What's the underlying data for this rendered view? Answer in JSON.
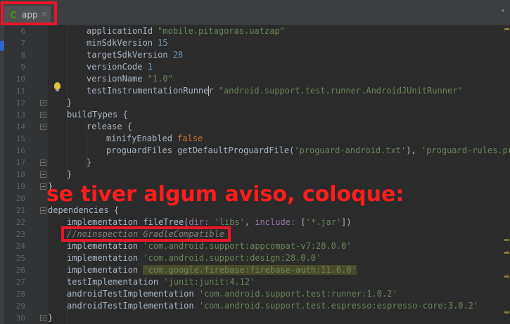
{
  "tab": {
    "label": "app",
    "close": "×"
  },
  "annotation": {
    "text": "se tiver algum aviso, coloque:"
  },
  "editor": {
    "line_numbers": [
      "6",
      "7",
      "8",
      "9",
      "10",
      "11",
      "12",
      "13",
      "14",
      "15",
      "16",
      "17",
      "18",
      "19",
      "20",
      "21",
      "22",
      "23",
      "24",
      "25",
      "26",
      "27",
      "28",
      "29",
      "30"
    ],
    "lines": {
      "l6": {
        "a": "applicationId ",
        "b": "\"mobile.pitagoras.uatzap\""
      },
      "l7": {
        "a": "minSdkVersion ",
        "b": "15"
      },
      "l8": {
        "a": "targetSdkVersion ",
        "b": "28"
      },
      "l9": {
        "a": "versionCode ",
        "b": "1"
      },
      "l10": {
        "a": "versionName ",
        "b": "\"1.0\""
      },
      "l11": {
        "a": "testInstrumentationRunner ",
        "b": "\"android.support.test.runner.AndroidJUnitRunner\""
      },
      "l12": {
        "a": "}"
      },
      "l13": {
        "a": "buildTypes {"
      },
      "l14": {
        "a": "release {"
      },
      "l15": {
        "a": "minifyEnabled ",
        "b": "false"
      },
      "l16": {
        "a": "proguardFiles getDefaultProguardFile(",
        "b": "'proguard-android.txt'",
        "c": "), ",
        "d": "'proguard-rules.pro'"
      },
      "l17": {
        "a": "}"
      },
      "l18": {
        "a": "}"
      },
      "l19": {
        "a": "}"
      },
      "l21": {
        "a": "dependencies {"
      },
      "l22": {
        "a": "implementation fileTree(",
        "b": "dir: ",
        "c": "'libs'",
        "d": ", ",
        "e": "include: ",
        "f": "[",
        "g": "'*.jar'",
        "h": "])"
      },
      "l23": {
        "a": "//noinspection GradleCompatible"
      },
      "l24": {
        "a": "implementation ",
        "b": "'com.android.support:appcompat-v7:28.0.0'"
      },
      "l25": {
        "a": "implementation ",
        "b": "'com.android.support:design:28.0.0'"
      },
      "l26": {
        "a": "implementation ",
        "b": "'com.google.firebase:firebase-auth:11.6.0'"
      },
      "l27": {
        "a": "testImplementation ",
        "b": "'junit:junit:4.12'"
      },
      "l28": {
        "a": "androidTestImplementation ",
        "b": "'com.android.support.test:runner:1.0.2'"
      },
      "l29": {
        "a": "androidTestImplementation ",
        "b": "'com.android.support.test.espresso:espresso-core:3.0.2'"
      },
      "l30": {
        "a": "}"
      }
    }
  },
  "colors": {
    "background": "#2b2b2b",
    "gutter": "#313335",
    "string": "#6a8759",
    "number": "#6897bb",
    "keyword": "#cc7832",
    "parameter": "#9876aa",
    "comment": "#808080",
    "annotation_red": "#e8162a"
  }
}
